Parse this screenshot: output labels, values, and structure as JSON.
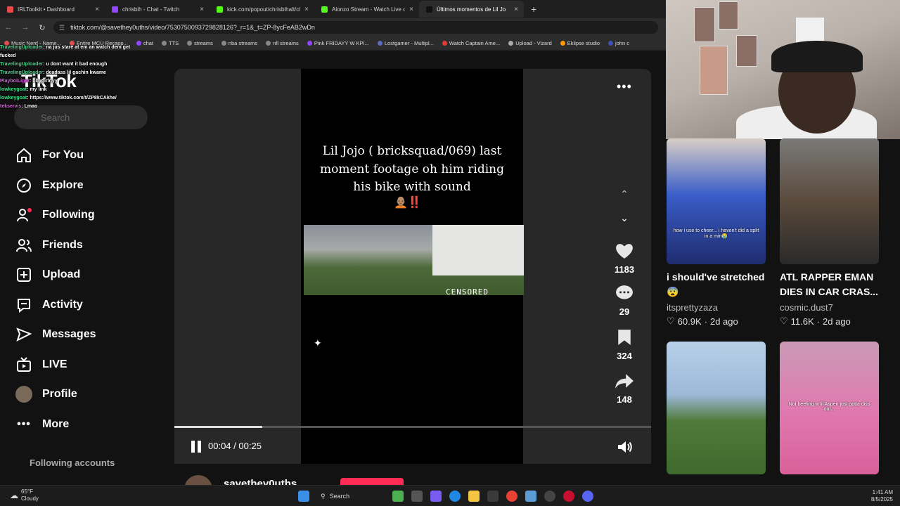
{
  "browser": {
    "tabs": [
      {
        "title": "IRLToolkit • Dashboard",
        "color": "#e84a4a"
      },
      {
        "title": "chrisbih - Chat - Twitch",
        "color": "#9146ff"
      },
      {
        "title": "kick.com/popout/chrisbihalt/cl",
        "color": "#53fc18"
      },
      {
        "title": "Alonzo Stream - Watch Live on",
        "color": "#53fc18"
      },
      {
        "title": "Últimos momentos de Lil Jo",
        "color": "#111111"
      }
    ],
    "address": "tiktok.com/@savethey0uths/video/7530750093729828126?_r=1&_t=ZP-8ycFeAB2wDn",
    "bookmarks": [
      "Music Nerd - Name...",
      "Entire MCU Recapp...",
      "chat",
      "TTS",
      "streams",
      "nba streams",
      "nfl streams",
      "Pink FRIDAYY W KPI...",
      "Lostgamer - Multipl...",
      "Watch Captain Ame...",
      "Upload - Vizard",
      "Eklipse studio",
      "john c"
    ]
  },
  "chat_overlay": [
    {
      "user": "TravelingUploader",
      "msg": "na jus stare at em an watch dem get fucked"
    },
    {
      "user": "TravelingUploader",
      "msg": "u dont want it bad enough"
    },
    {
      "user": "TravelingUploader",
      "msg": "deadass lil gachin kwame"
    },
    {
      "user": "PlayboiLiger",
      "msg": "bbygirlnyy"
    },
    {
      "user": "lowkeygoat",
      "msg": "my link"
    },
    {
      "user": "lowkeygoat",
      "msg": "https://www.tiktok.com/t/ZP8kCAkhe/"
    },
    {
      "user": "tekservis",
      "msg": "Lmao"
    }
  ],
  "tiktok": {
    "logo": "TikTok",
    "search_placeholder": "Search",
    "nav": [
      {
        "label": "For You",
        "icon": "home-icon"
      },
      {
        "label": "Explore",
        "icon": "compass-icon"
      },
      {
        "label": "Following",
        "icon": "following-icon"
      },
      {
        "label": "Friends",
        "icon": "friends-icon"
      },
      {
        "label": "Upload",
        "icon": "upload-icon"
      },
      {
        "label": "Activity",
        "icon": "activity-icon"
      },
      {
        "label": "Messages",
        "icon": "messages-icon"
      },
      {
        "label": "LIVE",
        "icon": "live-icon"
      },
      {
        "label": "Profile",
        "icon": "avatar-icon"
      },
      {
        "label": "More",
        "icon": "more-icon"
      }
    ],
    "following_accounts_label": "Following accounts"
  },
  "video": {
    "caption": "Lil Jojo ( bricksquad/069) last moment footage oh him riding his bike with sound",
    "caption_emoji": "🧑🏽‍🦲‼️",
    "censored_label": "CENSORED",
    "likes": "1183",
    "comments": "29",
    "saves": "324",
    "shares": "148",
    "time_current": "00:04",
    "time_total": "00:25",
    "progress": 0.184,
    "author": "savethey0uths"
  },
  "recommended": [
    {
      "title": "i should've stretched 😨",
      "user": "itsprettyzaza",
      "likes": "60.9K",
      "age": "2d ago",
      "thumb_text": "how i use to cheer... i haven't did a split in a min😭"
    },
    {
      "title": "ATL RAPPER EMAN DIES IN CAR CRAS...",
      "user": "cosmic.dust7",
      "likes": "11.6K",
      "age": "2d ago",
      "thumb_text": ""
    },
    {
      "title": "",
      "user": "",
      "likes": "",
      "age": "",
      "thumb_text": ""
    },
    {
      "title": "",
      "user": "",
      "likes": "",
      "age": "",
      "thumb_text": "Not beefing w lil Aspen just gotta diss out..."
    }
  ],
  "taskbar": {
    "temp": "65°F",
    "condition": "Cloudy",
    "search": "Search",
    "time": "1:41 AM",
    "date": "8/5/2025"
  }
}
